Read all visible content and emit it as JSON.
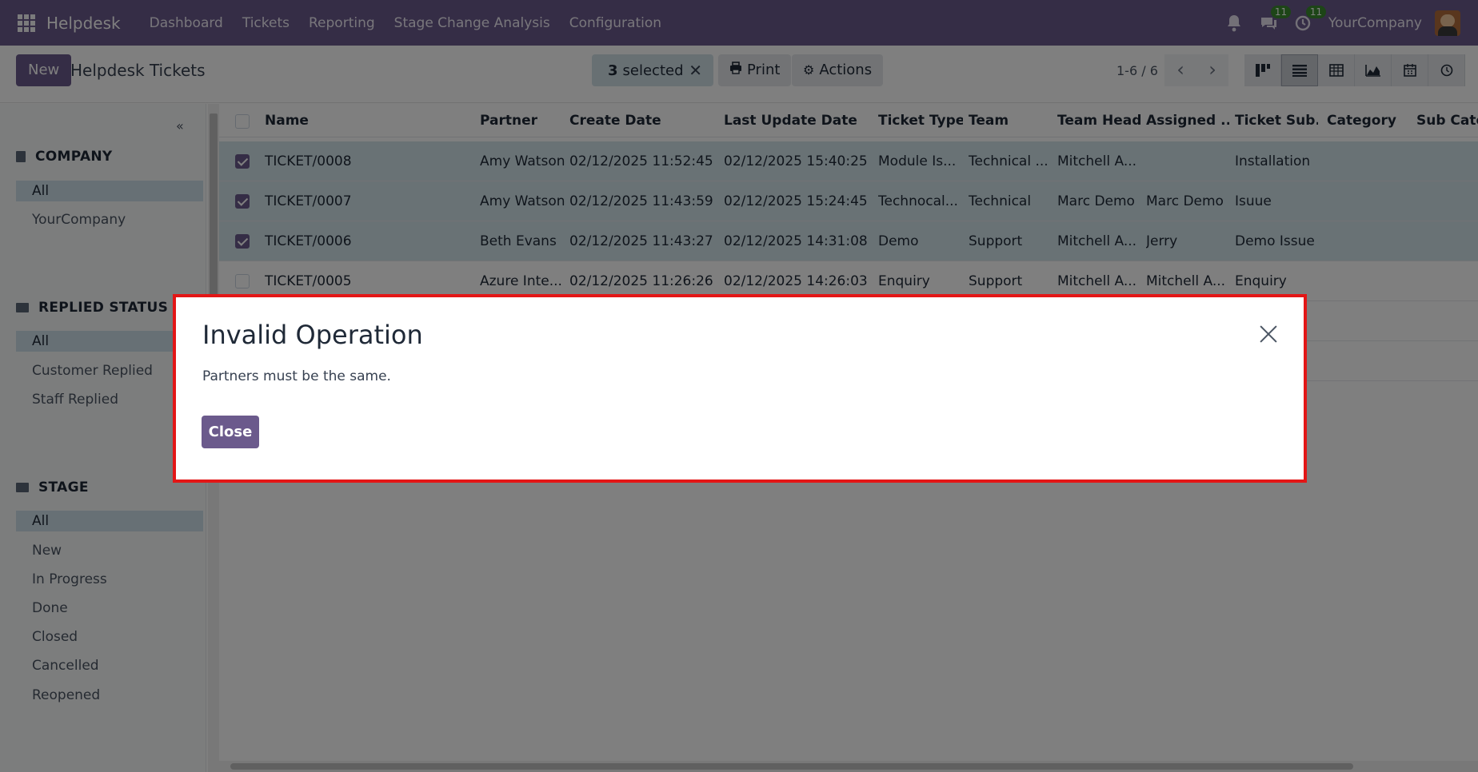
{
  "navbar": {
    "brand": "Helpdesk",
    "menu": [
      "Dashboard",
      "Tickets",
      "Reporting",
      "Stage Change Analysis",
      "Configuration"
    ],
    "messages_count": "11",
    "activities_count": "11",
    "company": "YourCompany"
  },
  "control": {
    "new_label": "New",
    "title": "Helpdesk Tickets",
    "selected_count": "3",
    "selected_label": "selected",
    "print_label": "Print",
    "actions_label": "Actions",
    "pager": "1-6 / 6"
  },
  "sidebar": {
    "company": {
      "title": "COMPANY",
      "items": [
        "All",
        "YourCompany"
      ]
    },
    "replied": {
      "title": "REPLIED STATUS",
      "items": [
        "All",
        "Customer Replied",
        "Staff Replied"
      ]
    },
    "stage": {
      "title": "STAGE",
      "items": [
        "All",
        "New",
        "In Progress",
        "Done",
        "Closed",
        "Cancelled",
        "Reopened"
      ]
    }
  },
  "table": {
    "columns": [
      "Name",
      "Partner",
      "Create Date",
      "Last Update Date",
      "Ticket Type",
      "Team",
      "Team Head",
      "Assigned ...",
      "Ticket Sub...",
      "Category",
      "Sub Categ"
    ],
    "rows": [
      [
        "TICKET/0008",
        "Amy Watson",
        "02/12/2025 11:52:45",
        "02/12/2025 15:40:25",
        "Module Is...",
        "Technical ...",
        "Mitchell A...",
        "",
        "Installation",
        "",
        ""
      ],
      [
        "TICKET/0007",
        "Amy Watson",
        "02/12/2025 11:43:59",
        "02/12/2025 15:24:45",
        "Technocal...",
        "Technical",
        "Marc Demo",
        "Marc Demo",
        "Isuue",
        "",
        ""
      ],
      [
        "TICKET/0006",
        "Beth Evans",
        "02/12/2025 11:43:27",
        "02/12/2025 14:31:08",
        "Demo",
        "Support",
        "Mitchell A...",
        "Jerry",
        "Demo Issue",
        "",
        ""
      ],
      [
        "TICKET/0005",
        "Azure Inte...",
        "02/12/2025 11:26:26",
        "02/12/2025 14:26:03",
        "Enquiry",
        "Support",
        "Mitchell A...",
        "Mitchell A...",
        "Enquiry",
        "",
        ""
      ],
      [
        "",
        "",
        "",
        "",
        "",
        "",
        "",
        "",
        "",
        "",
        ""
      ],
      [
        "",
        "",
        "",
        "",
        "",
        "",
        "",
        "",
        "",
        "",
        ""
      ]
    ]
  },
  "dialog": {
    "title": "Invalid Operation",
    "message": "Partners must be the same.",
    "close_label": "Close"
  }
}
